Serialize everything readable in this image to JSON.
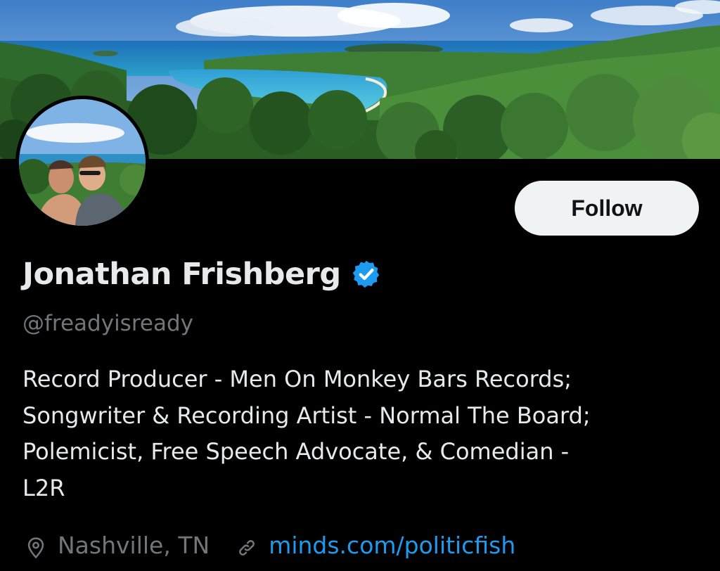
{
  "profile": {
    "display_name": "Jonathan Frishberg",
    "handle": "@freadyisready",
    "verified": true,
    "bio_lines": [
      "Record Producer - Men On Monkey Bars Records;",
      "Songwriter & Recording Artist - Normal The Board;",
      "Polemicist, Free Speech Advocate, & Comedian -",
      "L2R"
    ],
    "location": "Nashville, TN",
    "website": "minds.com/politicfish"
  },
  "actions": {
    "follow_label": "Follow"
  },
  "icons": {
    "verified": "verified-badge-icon",
    "location": "location-pin-icon",
    "link": "link-icon"
  },
  "colors": {
    "background": "#000000",
    "primary_text": "#e7e9ea",
    "secondary_text": "#71767b",
    "link": "#1d9bf0",
    "verified": "#1d9bf0",
    "button_bg": "#eff3f4",
    "button_text": "#0f1419"
  }
}
